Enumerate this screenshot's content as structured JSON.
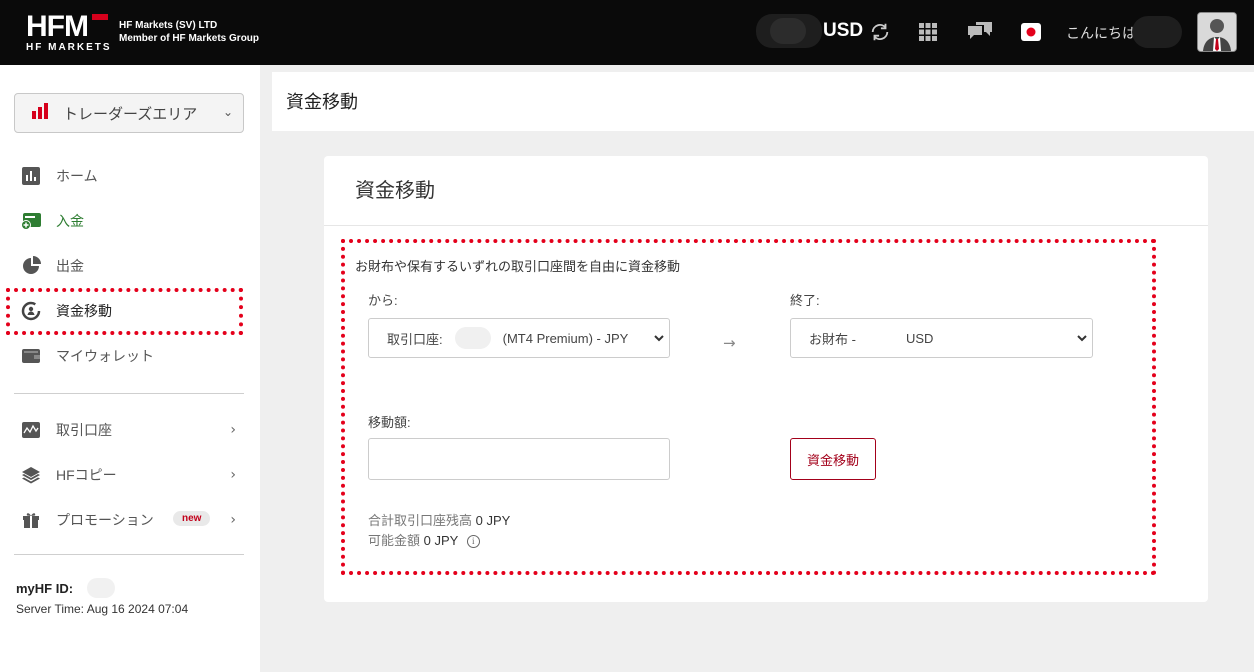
{
  "header": {
    "logo_text": "HFM",
    "logo_sub": "HF MARKETS",
    "company_line1": "HF Markets (SV) LTD",
    "company_line2": "Member of HF Markets Group",
    "currency": "USD",
    "greeting": "こんにちは",
    "icons": [
      "refresh-icon",
      "apps-grid-icon",
      "chat-icon",
      "flag-japan-icon",
      "avatar"
    ]
  },
  "sidebar": {
    "area_select": "トレーダーズエリア",
    "items": [
      {
        "label": "ホーム",
        "icon": "chart-icon"
      },
      {
        "label": "入金",
        "icon": "deposit-icon"
      },
      {
        "label": "出金",
        "icon": "withdraw-icon"
      },
      {
        "label": "資金移動",
        "icon": "transfer-icon"
      },
      {
        "label": "マイウォレット",
        "icon": "wallet-icon"
      }
    ],
    "secondary": [
      {
        "label": "取引口座",
        "icon": "trading-account-icon"
      },
      {
        "label": "HFコピー",
        "icon": "layers-icon"
      },
      {
        "label": "プロモーション",
        "icon": "gift-icon",
        "badge": "new"
      }
    ],
    "myhf_label": "myHF ID:",
    "server_time": "Server Time: Aug 16 2024 07:04"
  },
  "main": {
    "page_title": "資金移動",
    "card_title": "資金移動",
    "description": "お財布や保有するいずれの取引口座間を自由に資金移動",
    "from_label": "から:",
    "from_value_prefix": "取引口座:",
    "from_value_suffix": "(MT4 Premium) - JPY",
    "to_label": "終了:",
    "to_value_prefix": "お財布 -",
    "to_value_suffix": "USD",
    "amount_label": "移動額:",
    "submit_label": "資金移動",
    "balance_label": "合計取引口座残高",
    "balance_value": "0 JPY",
    "available_label": "可能金額",
    "available_value": "0 JPY"
  },
  "colors": {
    "brand_red": "#d6001c",
    "highlight_red": "#e4001b",
    "button_red": "#a3001a",
    "topbar": "#0a0a0a"
  }
}
